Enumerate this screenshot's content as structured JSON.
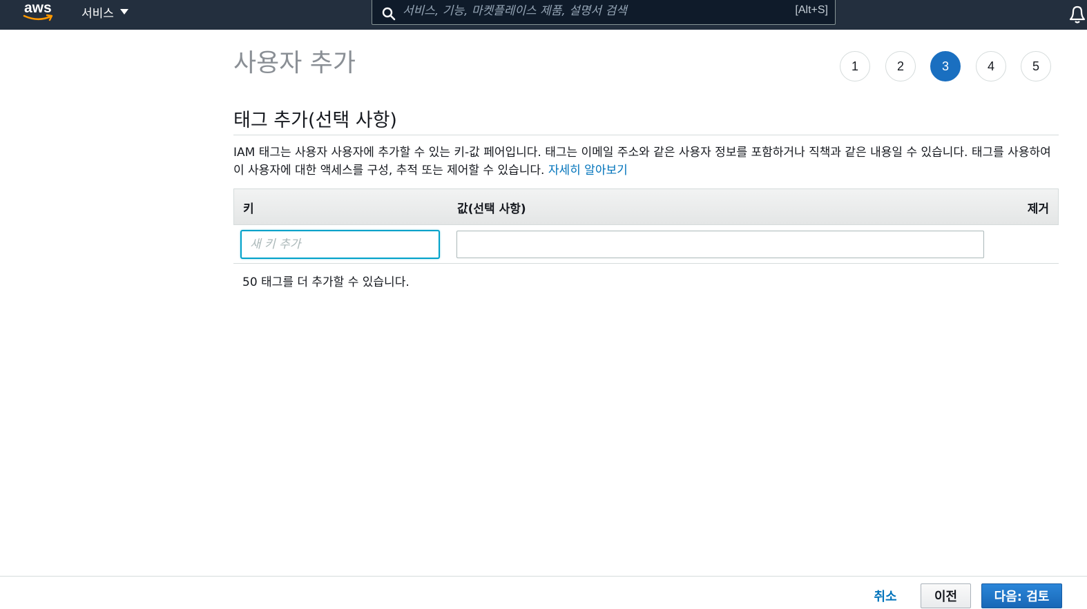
{
  "nav": {
    "logo_text": "aws",
    "services_label": "서비스",
    "search_placeholder": "서비스, 기능, 마켓플레이스 제품, 설명서 검색",
    "search_shortcut": "[Alt+S]"
  },
  "page": {
    "title": "사용자 추가",
    "steps": [
      "1",
      "2",
      "3",
      "4",
      "5"
    ],
    "active_step": "3"
  },
  "section": {
    "title": "태그 추가(선택 사항)",
    "description": "IAM 태그는 사용자 사용자에 추가할 수 있는 키-값 페어입니다. 태그는 이메일 주소와 같은 사용자 정보를 포함하거나 직책과 같은 내용일 수 있습니다. 태그를 사용하여 이 사용자에 대한 액세스를 구성, 추적 또는 제어할 수 있습니다.",
    "learn_more": "자세히 알아보기"
  },
  "table": {
    "col_key": "키",
    "col_value": "값(선택 사항)",
    "col_remove": "제거",
    "key_placeholder": "새 키 추가",
    "key_value": "",
    "value_value": "",
    "remaining_text": "50 태그를 더 추가할 수 있습니다."
  },
  "footer": {
    "cancel": "취소",
    "previous": "이전",
    "next": "다음: 검토"
  },
  "colors": {
    "nav_bg": "#232f3e",
    "active_step": "#1a6fc0",
    "link": "#0073bb",
    "primary_button": "#1f76c9"
  }
}
